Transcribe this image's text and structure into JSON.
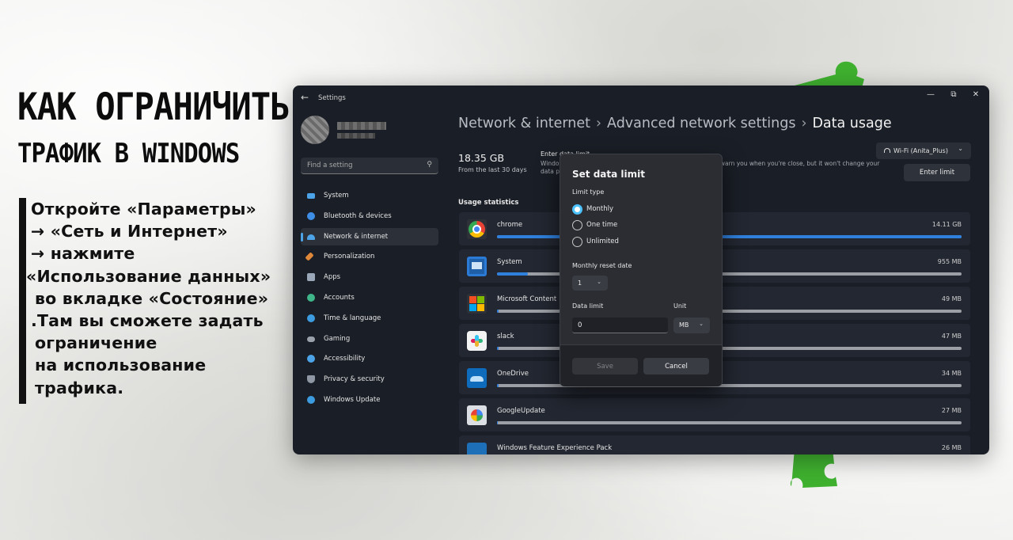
{
  "poster": {
    "headline_line1": "КАК ОГРАНИЧИТЬ",
    "headline_line2": "ТРАФИК В WINDOWS",
    "instructions": [
      "Откройте «Параметры»",
      "→ «Сеть и Интернет»",
      "→ нажмите",
      "«Использование данных»",
      "во вкладке «Состояние»",
      ".Там вы сможете задать",
      "ограничение",
      "на использование",
      "трафика."
    ]
  },
  "window": {
    "title": "Settings",
    "back_icon": "←",
    "controls": {
      "minimize": "—",
      "maximize": "⧉",
      "close": "✕"
    },
    "search_placeholder": "Find a setting",
    "search_icon": "⚲",
    "nav": [
      {
        "label": "System",
        "icon": "system-icon",
        "color": "#4ca3e8"
      },
      {
        "label": "Bluetooth & devices",
        "icon": "bluetooth-icon",
        "color": "#3f8ee6"
      },
      {
        "label": "Network & internet",
        "icon": "wifi-icon",
        "color": "#4ca3e8",
        "active": true
      },
      {
        "label": "Personalization",
        "icon": "brush-icon",
        "color": "#e0883a"
      },
      {
        "label": "Apps",
        "icon": "apps-icon",
        "color": "#9aa7b8"
      },
      {
        "label": "Accounts",
        "icon": "accounts-icon",
        "color": "#3fb58a"
      },
      {
        "label": "Time & language",
        "icon": "globe-icon",
        "color": "#3d9be0"
      },
      {
        "label": "Gaming",
        "icon": "gaming-icon",
        "color": "#9aa1ab"
      },
      {
        "label": "Accessibility",
        "icon": "accessibility-icon",
        "color": "#4ca3e8"
      },
      {
        "label": "Privacy & security",
        "icon": "shield-icon",
        "color": "#8e97a3"
      },
      {
        "label": "Windows Update",
        "icon": "update-icon",
        "color": "#3d9be0"
      }
    ],
    "breadcrumb": {
      "part1": "Network & internet",
      "part2": "Advanced network settings",
      "current": "Data usage",
      "separator": "›"
    },
    "total_usage": "18.35 GB",
    "total_period": "From the last 30 days",
    "limit_heading": "Enter data limit",
    "limit_text": "Windows will set a data limit to help you stay under it. We'll warn you when you're close, but it won't change your data plan",
    "network_selector": "Wi-Fi (Anita_Plus)",
    "network_selector_chevron": "⌄",
    "enter_limit_button": "Enter limit",
    "usage_stats_heading": "Usage statistics",
    "apps": [
      {
        "name": "chrome",
        "size": "14.11 GB",
        "share": 1.0,
        "icon": "chrome-icon"
      },
      {
        "name": "System",
        "size": "955 MB",
        "share": 0.066,
        "icon": "system-app-icon"
      },
      {
        "name": "Microsoft Content",
        "size": "49 MB",
        "share": 0.004,
        "icon": "microsoft-content-icon"
      },
      {
        "name": "slack",
        "size": "47 MB",
        "share": 0.004,
        "icon": "slack-icon"
      },
      {
        "name": "OneDrive",
        "size": "34 MB",
        "share": 0.003,
        "icon": "onedrive-icon"
      },
      {
        "name": "GoogleUpdate",
        "size": "27 MB",
        "share": 0.002,
        "icon": "google-update-icon"
      },
      {
        "name": "Windows Feature Experience Pack",
        "size": "26 MB",
        "share": 0.002,
        "icon": "feature-pack-icon"
      }
    ],
    "colors": {
      "accent": "#2f7fdc",
      "radio_accent": "#4cc2ff"
    }
  },
  "dialog": {
    "title": "Set data limit",
    "limit_type_label": "Limit type",
    "options": [
      "Monthly",
      "One time",
      "Unlimited"
    ],
    "selected_option": "Monthly",
    "reset_date_label": "Monthly reset date",
    "reset_date_value": "1",
    "data_limit_label": "Data limit",
    "data_limit_value": "0",
    "unit_label": "Unit",
    "unit_value": "MB",
    "chevron": "⌄",
    "save_label": "Save",
    "cancel_label": "Cancel"
  }
}
